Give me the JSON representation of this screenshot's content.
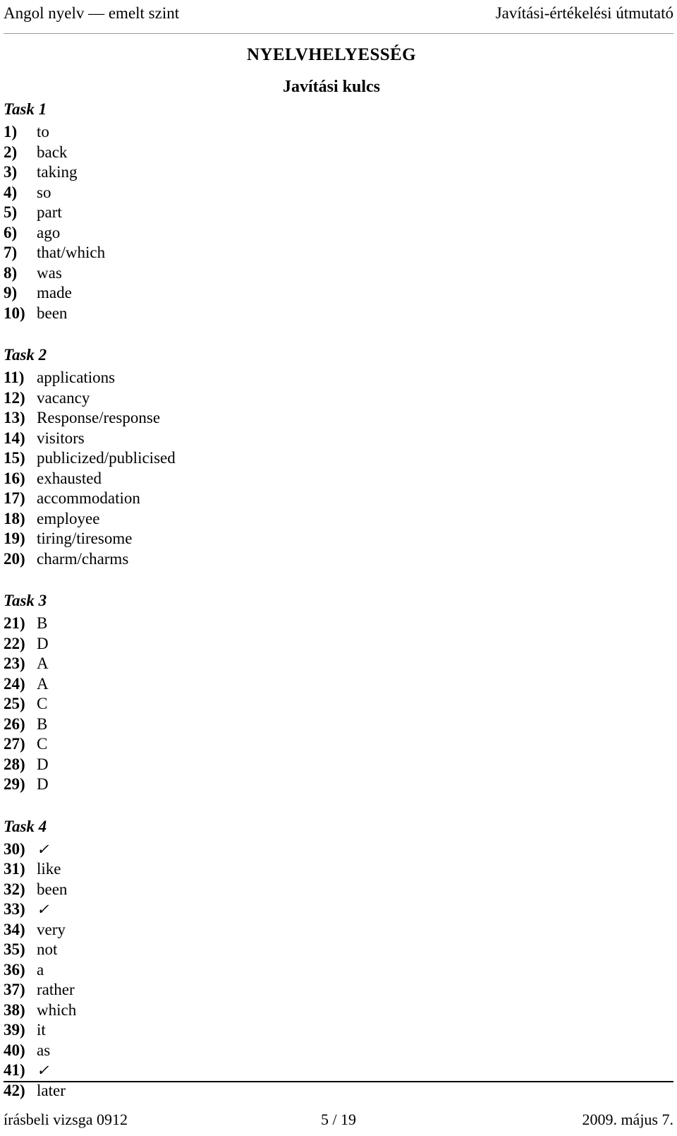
{
  "header": {
    "left": "Angol nyelv — emelt szint",
    "right": "Javítási-értékelési útmutató"
  },
  "titles": {
    "main": "NYELVHELYESSÉG",
    "sub": "Javítási kulcs"
  },
  "tasks": [
    {
      "heading": "Task 1",
      "items": [
        {
          "num": "1)",
          "answer": "to"
        },
        {
          "num": "2)",
          "answer": "back"
        },
        {
          "num": "3)",
          "answer": "taking"
        },
        {
          "num": "4)",
          "answer": "so"
        },
        {
          "num": "5)",
          "answer": "part"
        },
        {
          "num": "6)",
          "answer": "ago"
        },
        {
          "num": "7)",
          "answer": "that/which"
        },
        {
          "num": "8)",
          "answer": "was"
        },
        {
          "num": "9)",
          "answer": "made"
        },
        {
          "num": "10)",
          "answer": "been"
        }
      ]
    },
    {
      "heading": "Task 2",
      "items": [
        {
          "num": "11)",
          "answer": "applications"
        },
        {
          "num": "12)",
          "answer": "vacancy"
        },
        {
          "num": "13)",
          "answer": "Response/response"
        },
        {
          "num": "14)",
          "answer": "visitors"
        },
        {
          "num": "15)",
          "answer": "publicized/publicised"
        },
        {
          "num": "16)",
          "answer": "exhausted"
        },
        {
          "num": "17)",
          "answer": "accommodation"
        },
        {
          "num": "18)",
          "answer": "employee"
        },
        {
          "num": "19)",
          "answer": "tiring/tiresome"
        },
        {
          "num": "20)",
          "answer": "charm/charms"
        }
      ]
    },
    {
      "heading": "Task 3",
      "items": [
        {
          "num": "21)",
          "answer": "B"
        },
        {
          "num": "22)",
          "answer": "D"
        },
        {
          "num": "23)",
          "answer": "A"
        },
        {
          "num": "24)",
          "answer": "A"
        },
        {
          "num": "25)",
          "answer": "C"
        },
        {
          "num": "26)",
          "answer": "B"
        },
        {
          "num": "27)",
          "answer": "C"
        },
        {
          "num": "28)",
          "answer": "D"
        },
        {
          "num": "29)",
          "answer": "D"
        }
      ]
    },
    {
      "heading": "Task 4",
      "items": [
        {
          "num": "30)",
          "answer": "✓",
          "icon": "checkmark-icon"
        },
        {
          "num": "31)",
          "answer": "like"
        },
        {
          "num": "32)",
          "answer": "been"
        },
        {
          "num": "33)",
          "answer": "✓",
          "icon": "checkmark-icon"
        },
        {
          "num": "34)",
          "answer": "very"
        },
        {
          "num": "35)",
          "answer": "not"
        },
        {
          "num": "36)",
          "answer": "a"
        },
        {
          "num": "37)",
          "answer": "rather"
        },
        {
          "num": "38)",
          "answer": "which"
        },
        {
          "num": "39)",
          "answer": "it"
        },
        {
          "num": "40)",
          "answer": "as"
        },
        {
          "num": "41)",
          "answer": "✓",
          "icon": "checkmark-icon"
        },
        {
          "num": "42)",
          "answer": "later"
        }
      ]
    }
  ],
  "footer": {
    "left": "írásbeli vizsga 0912",
    "page": "5 / 19",
    "right": "2009. május 7."
  }
}
